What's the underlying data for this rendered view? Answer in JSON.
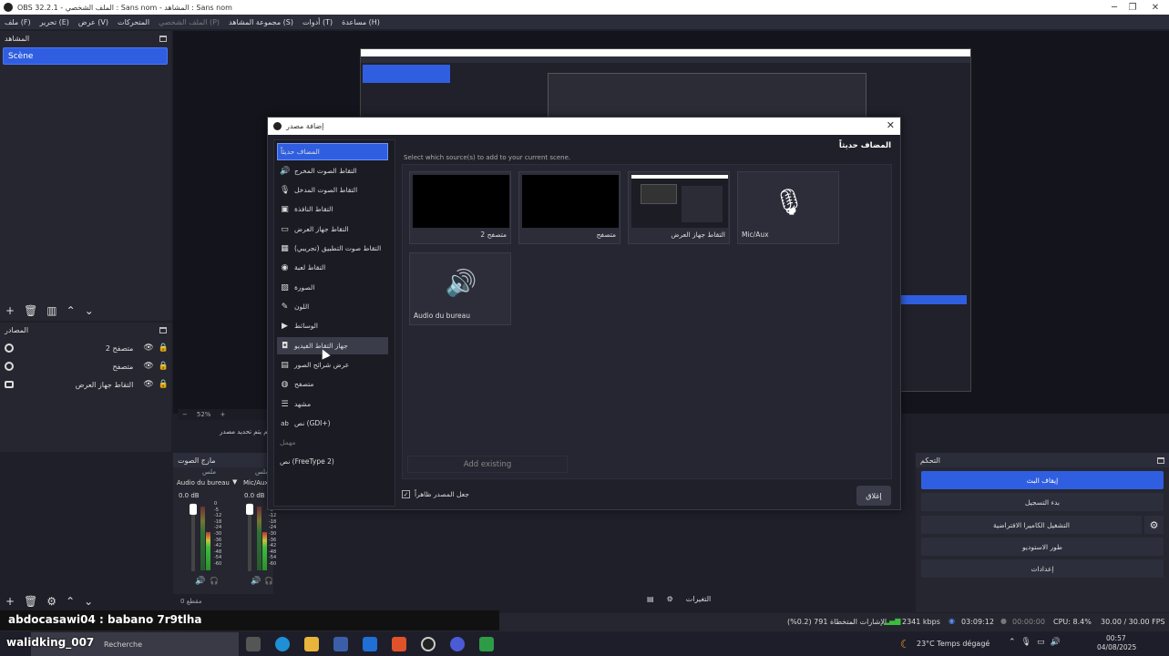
{
  "window": {
    "title": "OBS 32.2.1 - الملف الشخصي : Sans nom - المشاهد : Sans nom"
  },
  "menu": {
    "items": [
      "ملف (F)",
      "تحرير (E)",
      "عرض (V)",
      "المتحركات",
      "الملف الشخصي (P)",
      "مجموعة المشاهد (S)",
      "أدوات (T)",
      "مساعدة (H)"
    ]
  },
  "scenes": {
    "title": "المشاهد",
    "items": [
      "Scène"
    ]
  },
  "sources": {
    "title": "المصادر",
    "items": [
      {
        "name": "متصفح 2",
        "icon": "globe-icon"
      },
      {
        "name": "متصفح",
        "icon": "globe-icon"
      },
      {
        "name": "التقاط جهاز العرض",
        "icon": "monitor-icon"
      }
    ]
  },
  "preview": {
    "zoom": "52%",
    "no_selection": "لم يتم تحديد مصدر"
  },
  "dialog": {
    "title": "إضافة مصدر",
    "heading": "المضاف حديثاً",
    "hint": "Select which source(s) to add to your current scene.",
    "types": [
      {
        "label": "المضاف حديثاً",
        "icon": ""
      },
      {
        "label": "التقاط الصوت المخرج",
        "icon": "🔊"
      },
      {
        "label": "التقاط الصوت المدخل",
        "icon": "🎙"
      },
      {
        "label": "التقاط النافذة",
        "icon": "▣"
      },
      {
        "label": "التقاط جهاز العرض",
        "icon": "▭"
      },
      {
        "label": "التقاط صوت التطبيق (تجريبي)",
        "icon": "▦"
      },
      {
        "label": "التقاط لعبة",
        "icon": "◉"
      },
      {
        "label": "الصورة",
        "icon": "▨"
      },
      {
        "label": "اللون",
        "icon": "✎"
      },
      {
        "label": "الوسائط",
        "icon": "▶"
      },
      {
        "label": "جهاز التقاط الفيديو",
        "icon": "◘"
      },
      {
        "label": "عرض شرائح الصور",
        "icon": "▤"
      },
      {
        "label": "متصفح",
        "icon": "◍"
      },
      {
        "label": "مشهد",
        "icon": "☰"
      },
      {
        "label": "نص (GDI+)",
        "icon": "ab"
      },
      {
        "label": "مهمل",
        "icon": ""
      },
      {
        "label": "نص (FreeType 2)",
        "icon": ""
      }
    ],
    "cards": [
      {
        "label": "متصفح 2",
        "kind": "black"
      },
      {
        "label": "متصفح",
        "kind": "black"
      },
      {
        "label": "التقاط جهاز العرض",
        "kind": "screen"
      },
      {
        "label": "Mic/Aux",
        "kind": "mic"
      },
      {
        "label": "Audio du bureau",
        "kind": "speaker"
      }
    ],
    "add_existing": "Add existing",
    "visible_checkbox": "جعل المصدر ظاهراً",
    "close": "إغلاق"
  },
  "mixer": {
    "title": "مازج الصوت",
    "channels": [
      {
        "name": "Audio du bureau",
        "db": "0.0 dB",
        "tag": "ملس"
      },
      {
        "name": "Mic/Aux",
        "db": "0.0 dB",
        "tag": "ملس"
      }
    ],
    "ticks": [
      "0",
      "-5",
      "-12",
      "-18",
      "-24",
      "-30",
      "-36",
      "-42",
      "-48",
      "-54",
      "-60"
    ]
  },
  "controls": {
    "title": "التحكم",
    "buttons": [
      "إيقاف البث",
      "بدء التسجيل",
      "التشغيل الكاميرا الافتراضية",
      "طور الاستوديو",
      "إعدادات"
    ]
  },
  "transitions": {
    "label": "التغيرات"
  },
  "status": {
    "dropped": "الإشارات المتخطاة 791 (0.2%)",
    "bitrate": "2341 kbps",
    "stream_time": "03:09:12",
    "rec_time": "00:00:00",
    "cpu": "CPU: 8.4%",
    "fps": "30.00 / 30.00 FPS",
    "duration": "مقطع 0"
  },
  "chat": {
    "line1": "abdocasawi04 : babano 7r9tlha",
    "line2": "walidking_007"
  },
  "taskbar": {
    "search": "Recherche",
    "weather": "23°C  Temps dégagé",
    "time": "00:57",
    "date": "04/08/2025"
  }
}
